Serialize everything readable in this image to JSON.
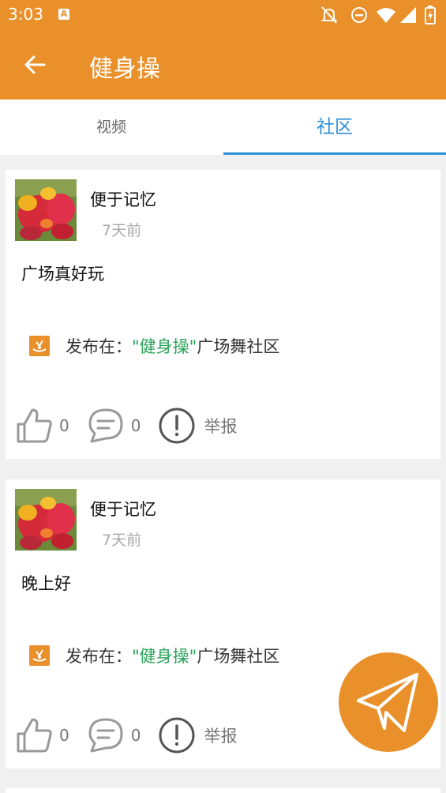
{
  "status_bar": {
    "time": "3:03",
    "badge": "A",
    "icons": [
      "notifications-off-icon",
      "do-not-disturb-icon",
      "wifi-icon",
      "cell-signal-icon",
      "battery-charging-icon"
    ]
  },
  "app_bar": {
    "title": "健身操",
    "back_icon": "back-arrow-icon"
  },
  "tabs": [
    {
      "label": "视频",
      "selected": false
    },
    {
      "label": "社区",
      "selected": true
    }
  ],
  "posts": [
    {
      "author": "便于记忆",
      "time": "7天前",
      "content": "广场真好玩",
      "posted_prefix": "发布在：",
      "posted_tag": "\"健身操\"",
      "posted_suffix": "广场舞社区",
      "likes": "0",
      "comments": "0",
      "report_label": "举报"
    },
    {
      "author": "便于记忆",
      "time": "7天前",
      "content": "晚上好",
      "posted_prefix": "发布在：",
      "posted_tag": "\"健身操\"",
      "posted_suffix": "广场舞社区",
      "likes": "0",
      "comments": "0",
      "report_label": "举报"
    }
  ],
  "fab": {
    "icon": "send-icon"
  },
  "colors": {
    "accent": "#EA902B",
    "tab_selected": "#2C8FD6",
    "tag_green": "#2BA35A"
  }
}
